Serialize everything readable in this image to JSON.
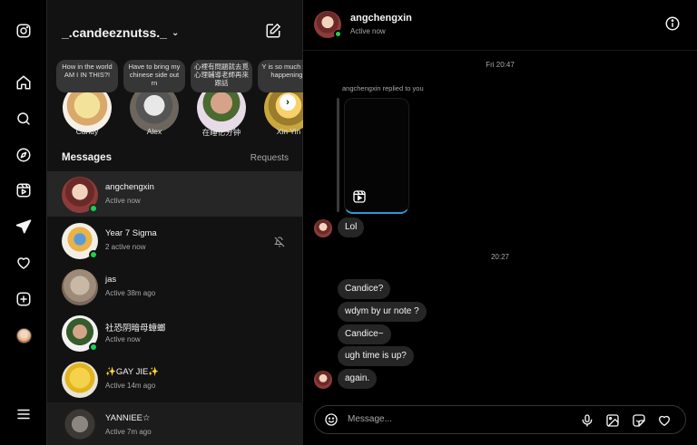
{
  "account": {
    "username": "_.candeeznutss._"
  },
  "notes": [
    {
      "text": "How in the world AM I IN THIS?!",
      "name": "Candy"
    },
    {
      "text": "Have to bring my chinese side out rn",
      "name": "Alex"
    },
    {
      "text": "心裡有問題就去覓心理輔導老師再來跟話",
      "name": "在睡亿分钟"
    },
    {
      "text": "Y is so much stuff happening !",
      "name": "Xin Yin"
    }
  ],
  "inbox": {
    "title": "Messages",
    "requests_label": "Requests"
  },
  "threads": [
    {
      "name": "angchengxin",
      "status": "Active now",
      "online": true,
      "active": true
    },
    {
      "name": "Year 7 Sigma",
      "status": "2 active now",
      "online": true,
      "muted": true
    },
    {
      "name": "jas",
      "status": "Active 38m ago",
      "online": false
    },
    {
      "name": "社恐阴暗母蟑螂",
      "status": "Active now",
      "online": true
    },
    {
      "name": "✨GAY JIE✨",
      "status": "Active 14m ago",
      "online": false
    },
    {
      "name": "YANNIEE☆",
      "status": "Active 7m ago",
      "online": false
    }
  ],
  "chat": {
    "name": "angchengxin",
    "status": "Active now",
    "timestamp_1": "Fri 20:47",
    "reply_label": "angchengxin replied to you",
    "timestamp_2": "20:27",
    "messages": [
      "Lol",
      "Candice?",
      "wdym by ur note ?",
      "Candice~",
      "ugh time is up?",
      "again."
    ],
    "composer_placeholder": "Message..."
  },
  "icons": {
    "rail": [
      "instagram-icon",
      "home-icon",
      "search-icon",
      "explore-icon",
      "reels-icon",
      "messages-icon",
      "heart-icon",
      "create-icon",
      "profile-avatar",
      "menu-icon"
    ],
    "online_color": "#1cd14f",
    "reel_accent": "#2a9bd6"
  }
}
